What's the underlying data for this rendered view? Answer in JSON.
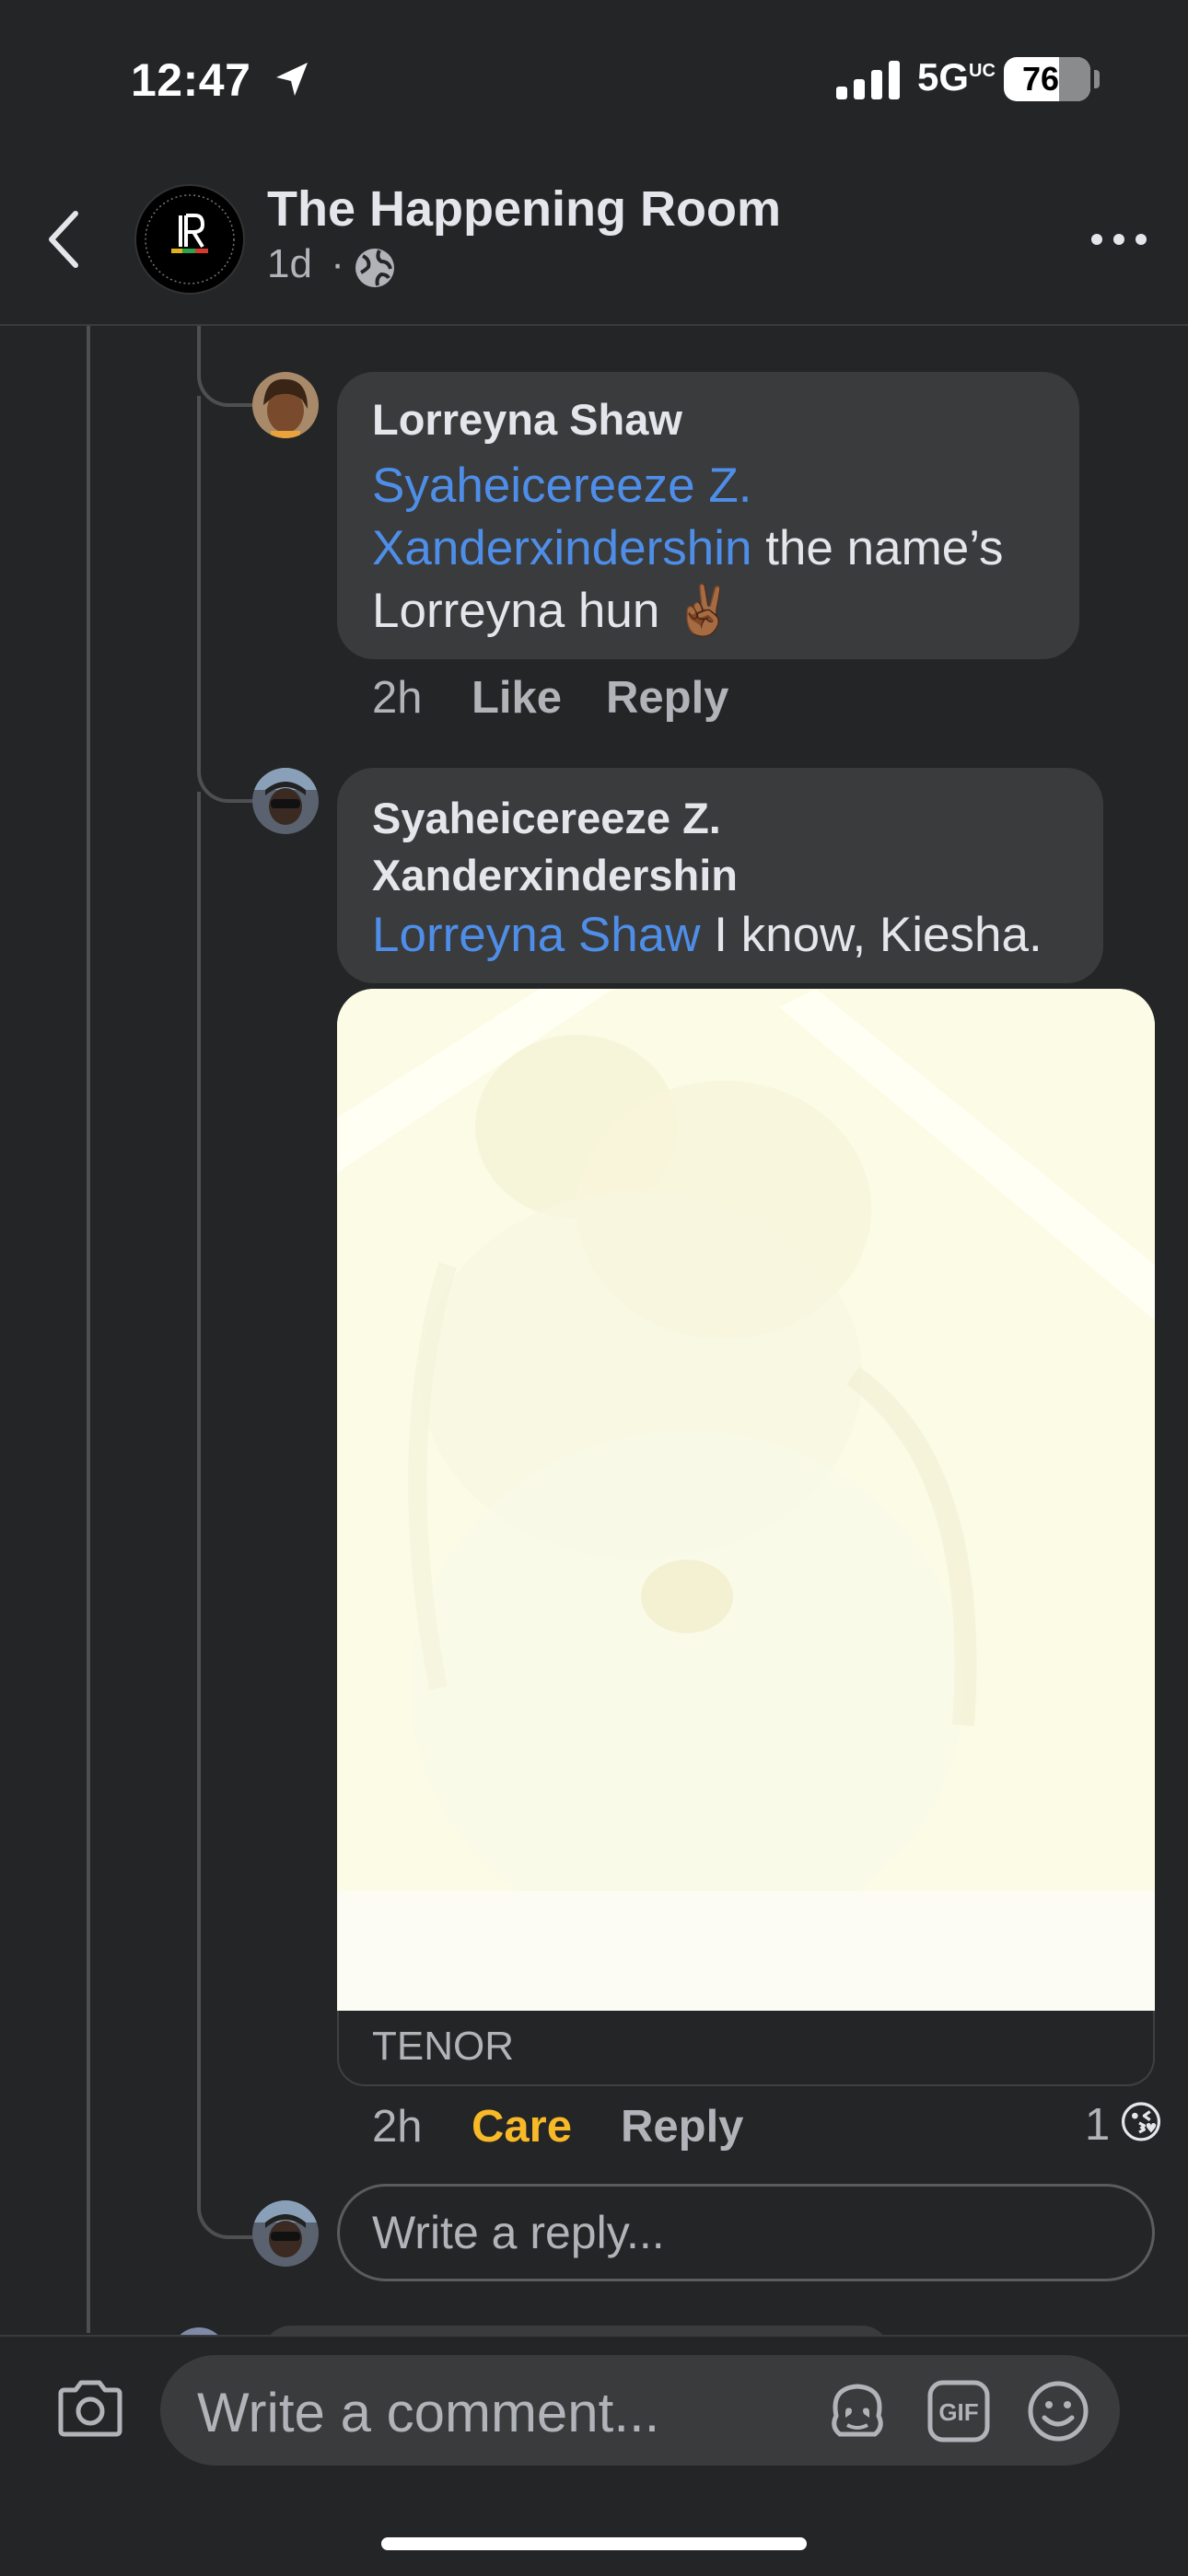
{
  "status_bar": {
    "time": "12:47",
    "network": "5G",
    "network_sup": "UC",
    "battery": "76"
  },
  "header": {
    "title": "The Happening Room",
    "age": "1d",
    "separator": "·"
  },
  "comments": [
    {
      "author": "Lorreyna Shaw",
      "mention": "Syaheicereeze Z. Xanderxindershin",
      "text": " the name’s Lorreyna hun ✌🏾",
      "time": "2h",
      "like_label": "Like",
      "reply_label": "Reply"
    },
    {
      "author": "Syaheicereeze Z. Xanderxindershin",
      "mention": "Lorreyna Shaw",
      "text": " I know, Kiesha.",
      "gif_source": "TENOR",
      "time": "2h",
      "reaction_label": "Care",
      "reply_label": "Reply",
      "reaction_count": "1",
      "reaction_emoji": "😘"
    }
  ],
  "reply_box": {
    "placeholder": "Write a reply..."
  },
  "comment_bar": {
    "placeholder": "Write a comment...",
    "gif_label": "GIF"
  },
  "colors": {
    "background": "#242526",
    "bubble": "#3a3b3c",
    "mention": "#4e8ee8",
    "care": "#f7b928",
    "muted": "#b0b3b8"
  },
  "icons": [
    "location-arrow-icon",
    "signal-icon",
    "battery-icon",
    "back-chevron-icon",
    "globe-icon",
    "more-icon",
    "camera-icon",
    "avatar-sticker-icon",
    "gif-icon",
    "emoji-icon"
  ]
}
